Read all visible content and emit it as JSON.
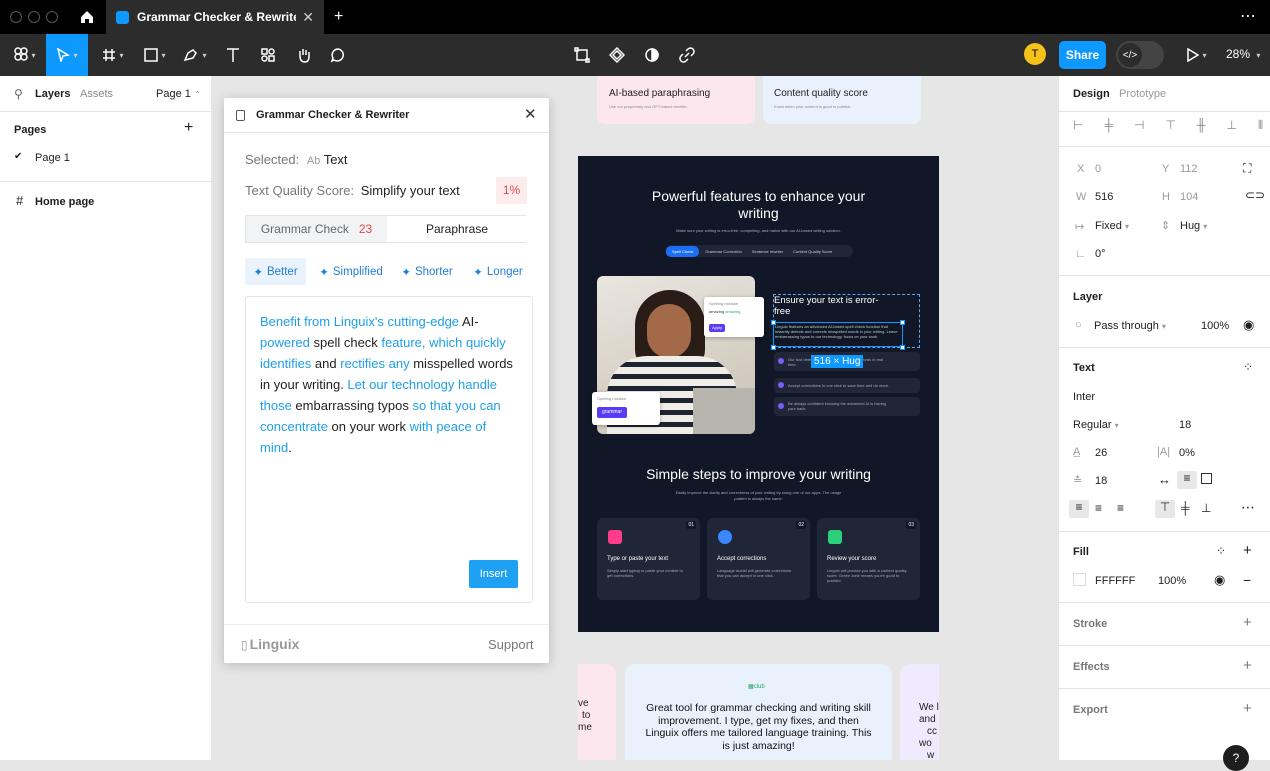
{
  "tab": {
    "title": "Grammar Checker & Rewriter (Com"
  },
  "toolbar": {
    "avatar": "T",
    "share": "Share",
    "zoom": "28%"
  },
  "left": {
    "layers": "Layers",
    "assets": "Assets",
    "page_selector": "Page 1",
    "pages_title": "Pages",
    "pages": [
      "Page 1"
    ],
    "frame": "Home page"
  },
  "plugin": {
    "title": "Grammar Checker & Rewriter",
    "selected_label": "Selected:",
    "selected_type": "Ab",
    "selected_value": "Text",
    "score_label": "Text Quality Score:",
    "score_value": "Simplify your text",
    "score_pct": "1%",
    "tabs": {
      "grammar": "Grammar Check",
      "grammar_count": "23",
      "paraphrase": "Paraphrase"
    },
    "modes": [
      "Better",
      "Simplified",
      "Shorter",
      "Longer"
    ],
    "text": [
      {
        "t": "Benefit from Linguix's cutting-edge",
        "b": true
      },
      {
        "t": " AI-",
        "b": false
      },
      {
        "t": "powered",
        "b": true
      },
      {
        "t": " spell check ",
        "b": false
      },
      {
        "t": "feature, which quickly identifies",
        "b": true
      },
      {
        "t": " and ",
        "b": false
      },
      {
        "t": "rectifies any",
        "b": true
      },
      {
        "t": " misspelled words in your writing. ",
        "b": false
      },
      {
        "t": "Let our technology handle those",
        "b": true
      },
      {
        "t": " embarrassing typos ",
        "b": false
      },
      {
        "t": "so that you can concentrate",
        "b": true
      },
      {
        "t": " on your work ",
        "b": false
      },
      {
        "t": "with peace of mind",
        "b": true
      },
      {
        "t": ".",
        "b": false
      }
    ],
    "insert": "Insert",
    "brand": "Linguix",
    "support": "Support"
  },
  "design": {
    "card1_title": "AI-based paraphrasing",
    "card1_sub": "Use our proprietary and GPT-based rewriter.",
    "card2_title": "Content quality score",
    "card2_sub": "Know when your content is good to publish.",
    "features_title": "Powerful features to enhance your writing",
    "features_sub": "Make sure your writing is error-free, compelling, and native with our AI-based writing solution.",
    "feature_tabs": [
      "Spell Check",
      "Grammar Correction",
      "Sentence rewriter",
      "Content Quality Score"
    ],
    "ensure_title": "Ensure your text is error-free",
    "ensure_body": "Linguix features an advanced AI-based spell check function that instantly detects and corrects misspelled words in your writing. Leave embarrassing typos to our technology, focus on your work.",
    "size_badge": "516 × Hug",
    "bullets": [
      "Our tool detects and corrects misspelled words in real time.",
      "Accept corrections in one click to save time and do more.",
      "Be always confident knowing the advanced AI is having your back."
    ],
    "popup1_label": "Spelling mistake",
    "popup1_wrong": "amazing",
    "popup1_right": "amazing",
    "popup1_btn": "Apply",
    "popup2_label": "Spelling mistake",
    "popup2_word": "grammar",
    "steps_title": "Simple steps to improve your writing",
    "steps_sub": "Easily improve the clarity and correctness of your writing by using one of our apps. The usage pattern is always the same:",
    "steps": [
      {
        "n": "01",
        "title": "Type or paste your text",
        "desc": "Simply start typing or paste your content to get corrections."
      },
      {
        "n": "02",
        "title": "Accept corrections",
        "desc": "Language model will generate corrections that you can accept in one click."
      },
      {
        "n": "03",
        "title": "Review your score",
        "desc": "Linguix will provide you with a content quality score. Green zone means you're good to publish!"
      }
    ],
    "testimonial_logo": "club",
    "testimonial": "Great tool for grammar checking and writing skill improvement. I type, get my fixes, and then Linguix offers me tailored language training. This is just amazing!",
    "left_frag": [
      "ve",
      "to",
      "me"
    ],
    "right_frag": [
      "We l",
      "and",
      "cc",
      "wo",
      "w"
    ]
  },
  "right": {
    "tabs": [
      "Design",
      "Prototype"
    ],
    "x_label": "X",
    "x": "0",
    "y_label": "Y",
    "y": "112",
    "w_label": "W",
    "w": "516",
    "h_label": "H",
    "h": "104",
    "wmode": "Fixed",
    "hmode": "Hug",
    "rotation": "0°",
    "layer_title": "Layer",
    "blend": "Pass through",
    "opacity": "100%",
    "text_title": "Text",
    "font": "Inter",
    "weight": "Regular",
    "size": "18",
    "line_height": "26",
    "letter_spacing": "0%",
    "para_spacing": "18",
    "fill_title": "Fill",
    "fill_hex": "FFFFFF",
    "fill_opacity": "100%",
    "stroke": "Stroke",
    "effects": "Effects",
    "export": "Export"
  },
  "colors": {
    "accent": "#0d99ff",
    "link": "#1e9fe6",
    "dark": "#111726"
  }
}
